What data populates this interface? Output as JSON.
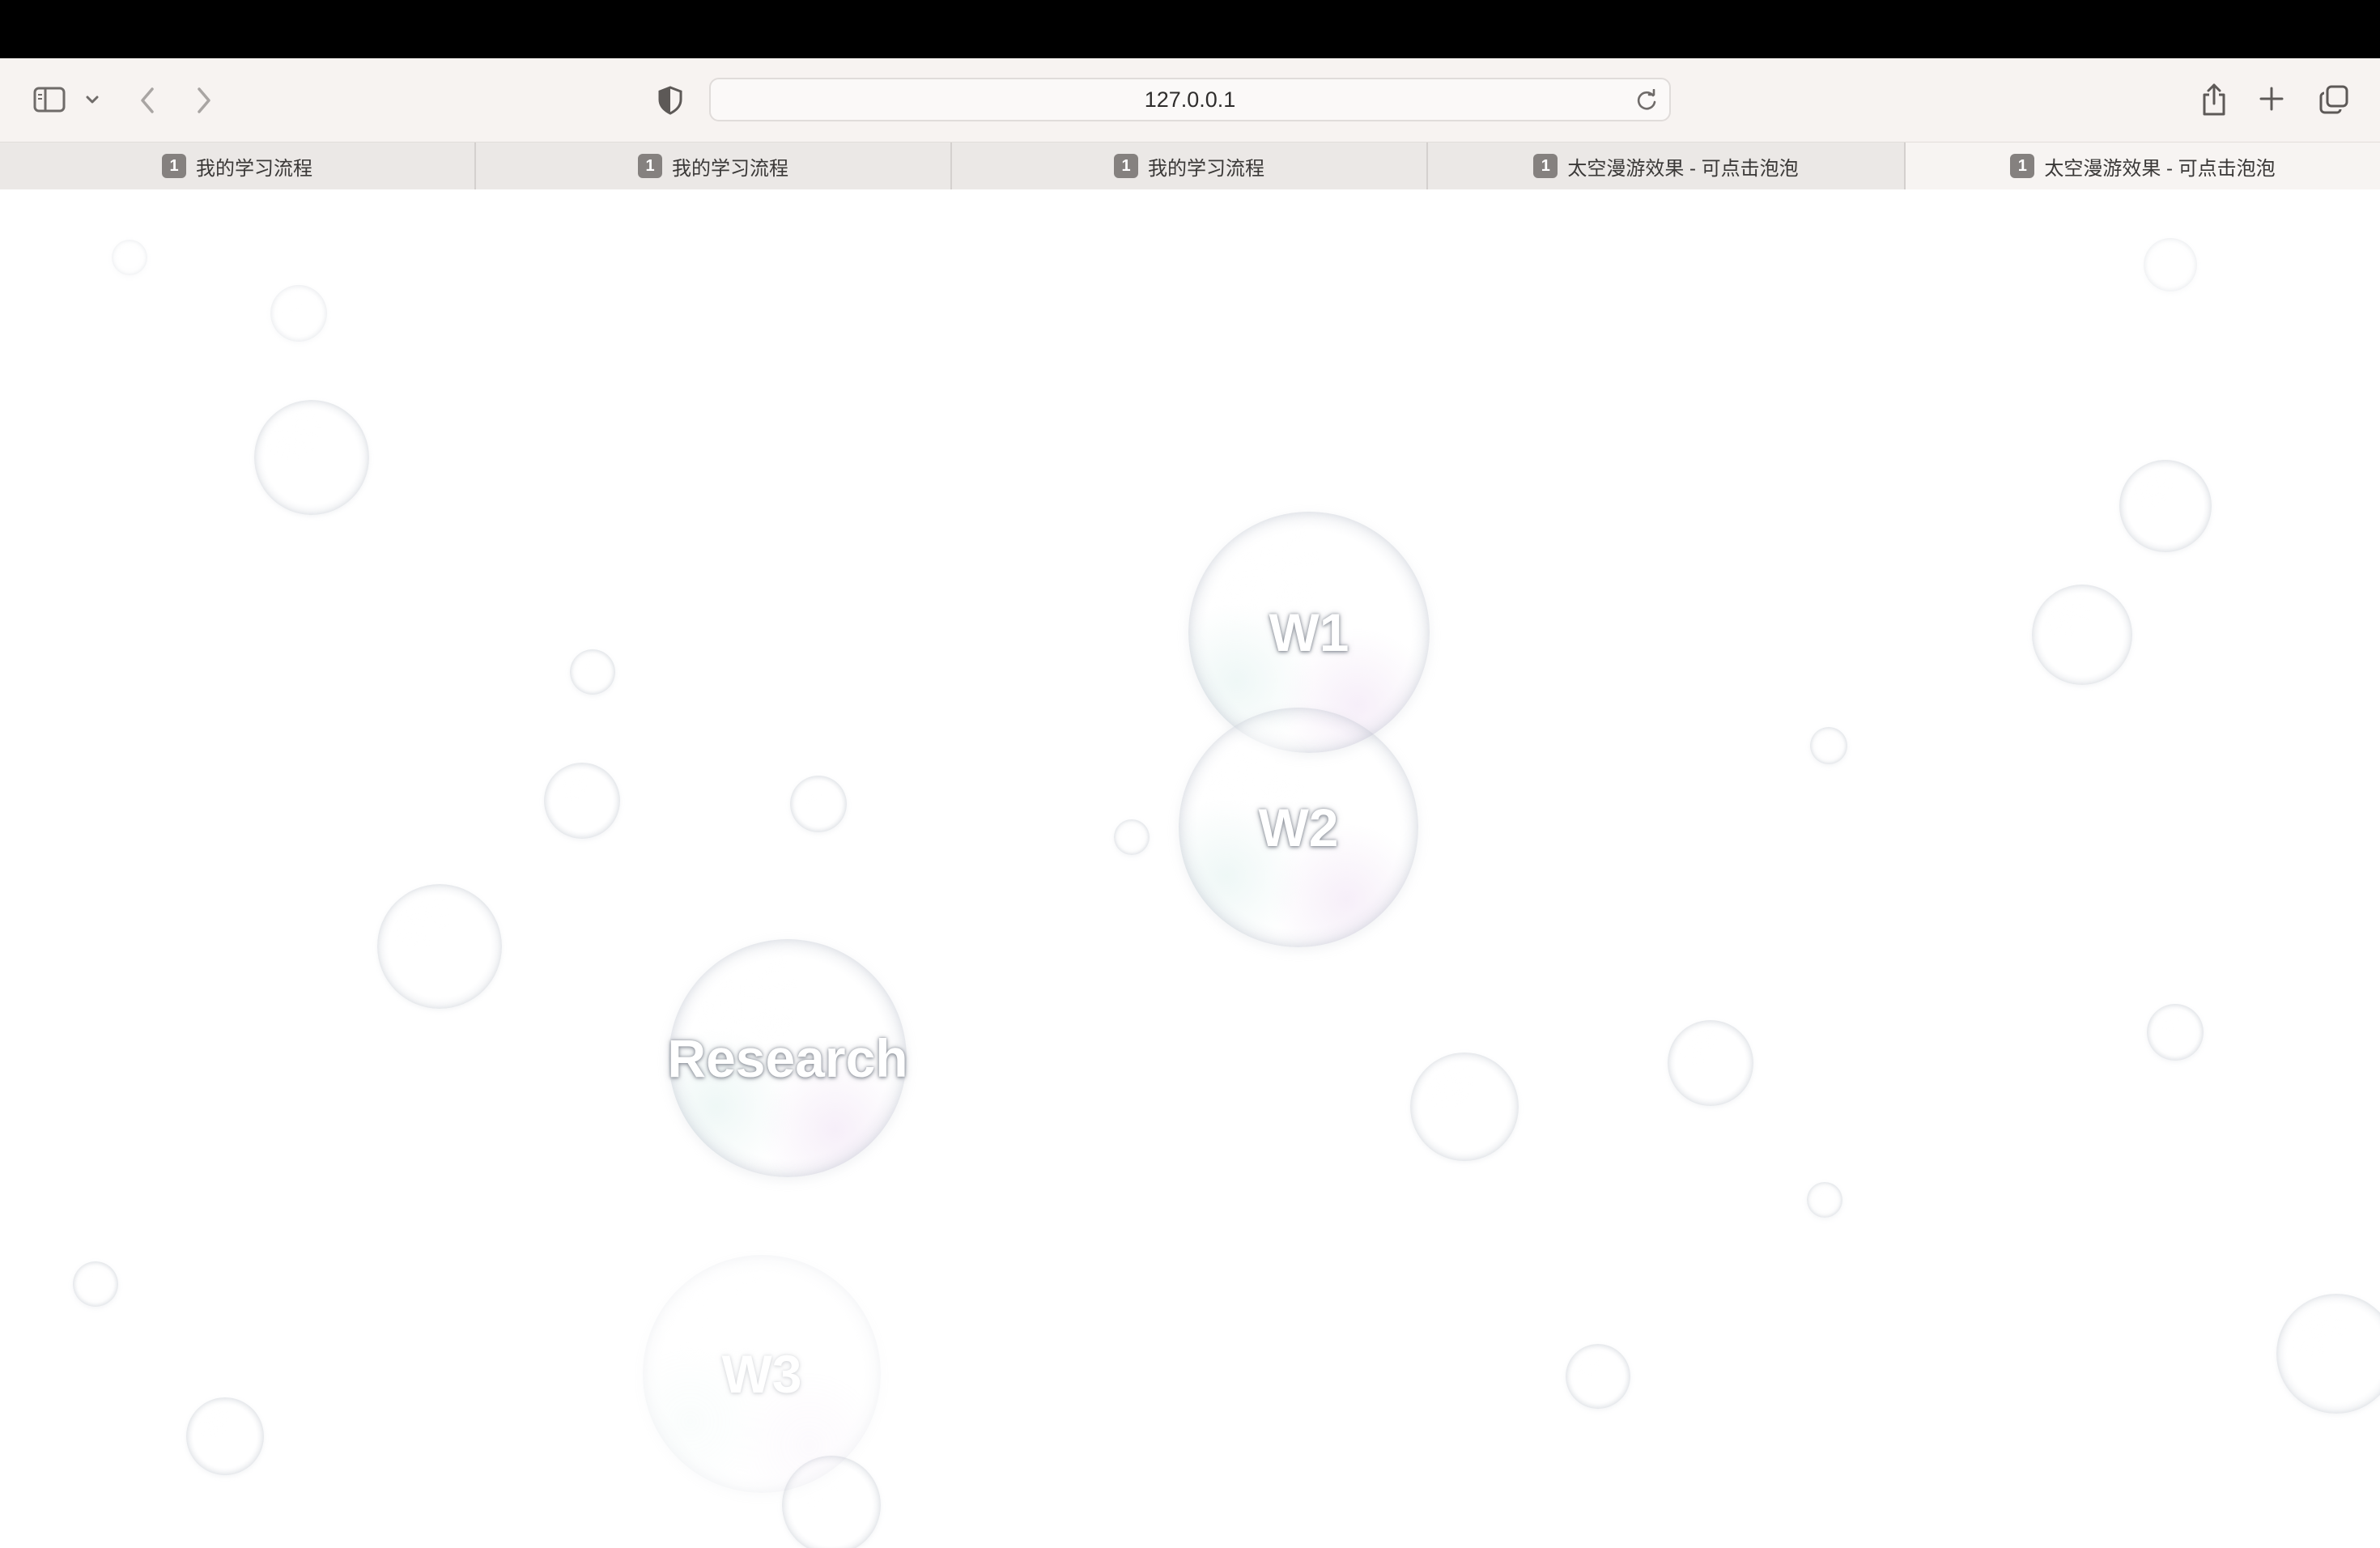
{
  "browser": {
    "address": "127.0.0.1",
    "tabs": [
      {
        "badge": "1",
        "title": "我的学习流程",
        "active": false
      },
      {
        "badge": "1",
        "title": "我的学习流程",
        "active": false
      },
      {
        "badge": "1",
        "title": "我的学习流程",
        "active": false
      },
      {
        "badge": "1",
        "title": "太空漫游效果 - 可点击泡泡",
        "active": false
      },
      {
        "badge": "1",
        "title": "太空漫游效果 - 可点击泡泡",
        "active": true
      }
    ]
  },
  "bubbles": {
    "w1": {
      "label": "W1"
    },
    "w2": {
      "label": "W2"
    },
    "research": {
      "label": "Research"
    },
    "w3": {
      "label": "W3"
    }
  }
}
